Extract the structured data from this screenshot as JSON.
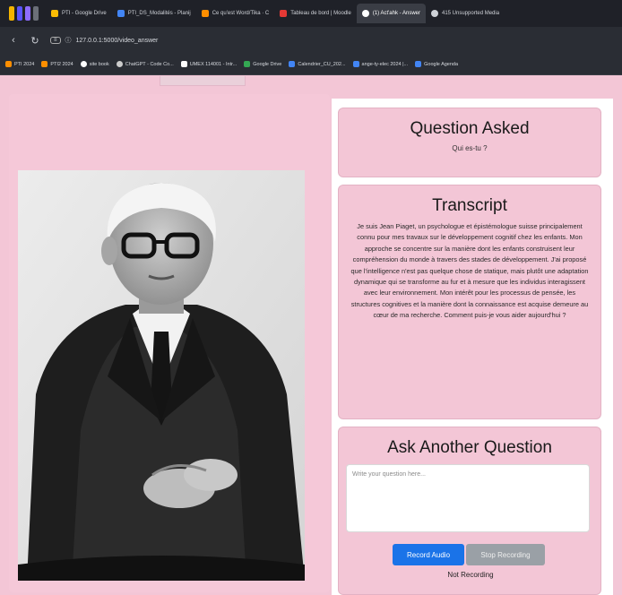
{
  "browser": {
    "tabs": [
      {
        "label": "PTI - Google Drive",
        "color": "#fbbc04",
        "active": false
      },
      {
        "label": "PTI_DS_Modalités - Planij",
        "color": "#4285f4",
        "active": false
      },
      {
        "label": "Ce qu'est Word/Tika · C",
        "color": "#ff8f00",
        "active": false
      },
      {
        "label": "Tableau de bord | Moodle",
        "color": "#e53935",
        "active": false
      },
      {
        "label": "(1) Act'ahk - Answer",
        "color": "#ffffff",
        "active": true
      },
      {
        "label": "415 Unsupported Media",
        "color": "#cfd2d8",
        "active": false
      }
    ],
    "url": "127.0.0.1:5000/video_answer",
    "bookmarks": [
      {
        "label": "PTI 2024",
        "color": "#ff8f00"
      },
      {
        "label": "PTI2 2024",
        "color": "#ff8f00"
      },
      {
        "label": "site book",
        "color": "#ffffff"
      },
      {
        "label": "ChatGPT - Code Co...",
        "color": "#cccccc"
      },
      {
        "label": "UMEX 114001 - Intr...",
        "color": "#ffffff"
      },
      {
        "label": "Google Drive",
        "color": "#34a853"
      },
      {
        "label": "Calendrier_CU_202...",
        "color": "#4285f4"
      },
      {
        "label": "ange-ty-elec 2024 |...",
        "color": "#4285f4"
      },
      {
        "label": "Google Agenda",
        "color": "#4285f4"
      }
    ]
  },
  "question_card": {
    "title": "Question Asked",
    "question": "Qui es-tu ?"
  },
  "transcript_card": {
    "title": "Transcript",
    "text": "Je suis Jean Piaget, un psychologue et épistémologue suisse principalement connu pour mes travaux sur le développement cognitif chez les enfants. Mon approche se concentre sur la manière dont les enfants construisent leur compréhension du monde à travers des stades de développement. J'ai proposé que l'intelligence n'est pas quelque chose de statique, mais plutôt une adaptation dynamique qui se transforme au fur et à mesure que les individus interagissent avec leur environnement. Mon intérêt pour les processus de pensée, les structures cognitives et la manière dont la connaissance est acquise demeure au cœur de ma recherche. Comment puis-je vous aider aujourd'hui ?"
  },
  "ask_card": {
    "title": "Ask Another Question",
    "placeholder": "Write your question here...",
    "record_label": "Record Audio",
    "stop_label": "Stop Recording",
    "status": "Not Recording"
  },
  "colors": {
    "page_bg": "#f3c6d6",
    "primary": "#1a73e8",
    "disabled": "#9aa0a6"
  }
}
